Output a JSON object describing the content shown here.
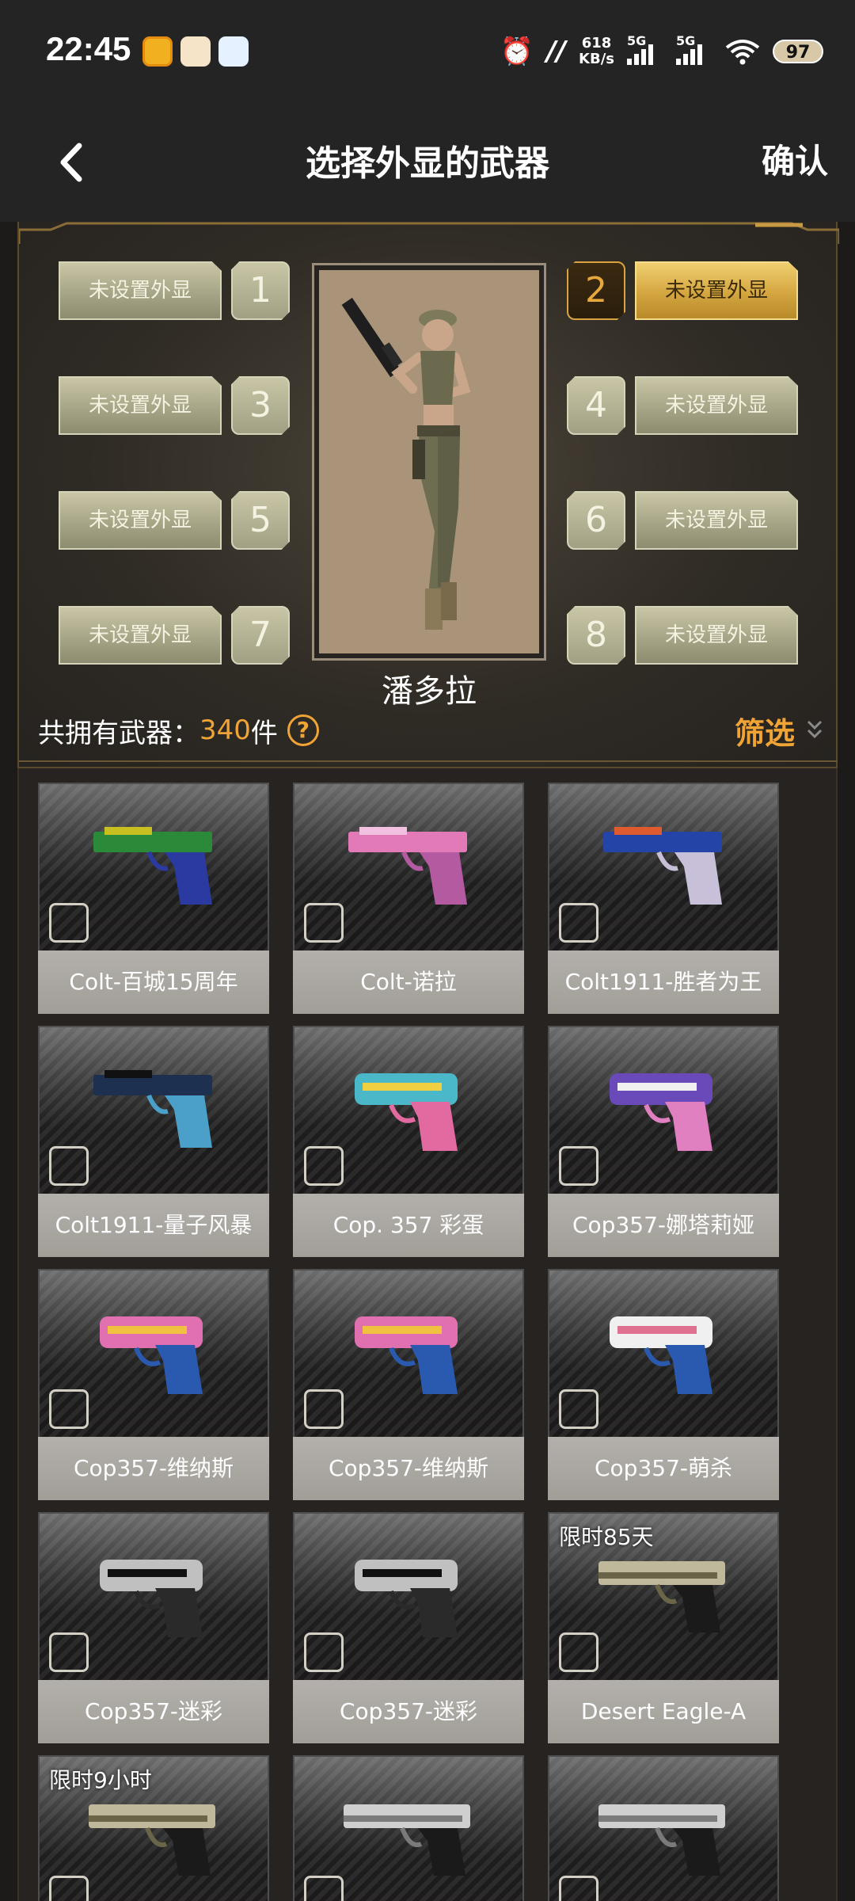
{
  "status_bar": {
    "time": "22:45",
    "net_speed_value": "618",
    "net_speed_unit": "KB/s",
    "signal_1": "5G",
    "signal_2": "5G",
    "battery": "97"
  },
  "header": {
    "title": "选择外显的武器",
    "confirm": "确认"
  },
  "loadout": {
    "character_name": "潘多拉",
    "slots": [
      {
        "number": "1",
        "label": "未设置外显"
      },
      {
        "number": "2",
        "label": "未设置外显"
      },
      {
        "number": "3",
        "label": "未设置外显"
      },
      {
        "number": "4",
        "label": "未设置外显"
      },
      {
        "number": "5",
        "label": "未设置外显"
      },
      {
        "number": "6",
        "label": "未设置外显"
      },
      {
        "number": "7",
        "label": "未设置外显"
      },
      {
        "number": "8",
        "label": "未设置外显"
      }
    ],
    "active_slot": "2",
    "owned_prefix": "共拥有武器：",
    "owned_count": "340",
    "owned_suffix": "件",
    "help": "?",
    "filter": "筛选"
  },
  "weapons": [
    {
      "name": "Colt-百城15周年",
      "badge": "",
      "icon": "pistol-colt-green"
    },
    {
      "name": "Colt-诺拉",
      "badge": "",
      "icon": "pistol-colt-pink"
    },
    {
      "name": "Colt1911-胜者为王",
      "badge": "",
      "icon": "pistol-colt-blue"
    },
    {
      "name": "Colt1911-量子风暴",
      "badge": "",
      "icon": "pistol-colt-dark"
    },
    {
      "name": "Cop. 357 彩蛋",
      "badge": "",
      "icon": "pistol-cop-teal"
    },
    {
      "name": "Cop357-娜塔莉娅",
      "badge": "",
      "icon": "pistol-cop-purple"
    },
    {
      "name": "Cop357-维纳斯",
      "badge": "",
      "icon": "pistol-cop-pink"
    },
    {
      "name": "Cop357-维纳斯",
      "badge": "",
      "icon": "pistol-cop-pink"
    },
    {
      "name": "Cop357-萌杀",
      "badge": "",
      "icon": "pistol-cop-blue"
    },
    {
      "name": "Cop357-迷彩",
      "badge": "",
      "icon": "pistol-cop-silver"
    },
    {
      "name": "Cop357-迷彩",
      "badge": "",
      "icon": "pistol-cop-silver"
    },
    {
      "name": "Desert Eagle-A",
      "badge": "限时85天",
      "icon": "pistol-deagle-camo"
    },
    {
      "name": "",
      "badge": "限时9小时",
      "icon": "pistol-deagle-camo"
    },
    {
      "name": "",
      "badge": "",
      "icon": "pistol-deagle-silver"
    },
    {
      "name": "",
      "badge": "",
      "icon": "pistol-deagle-silver"
    }
  ],
  "colors": {
    "accent": "#f1a436",
    "active_slot_gold": "#d4a640",
    "header_bg": "#242424"
  }
}
